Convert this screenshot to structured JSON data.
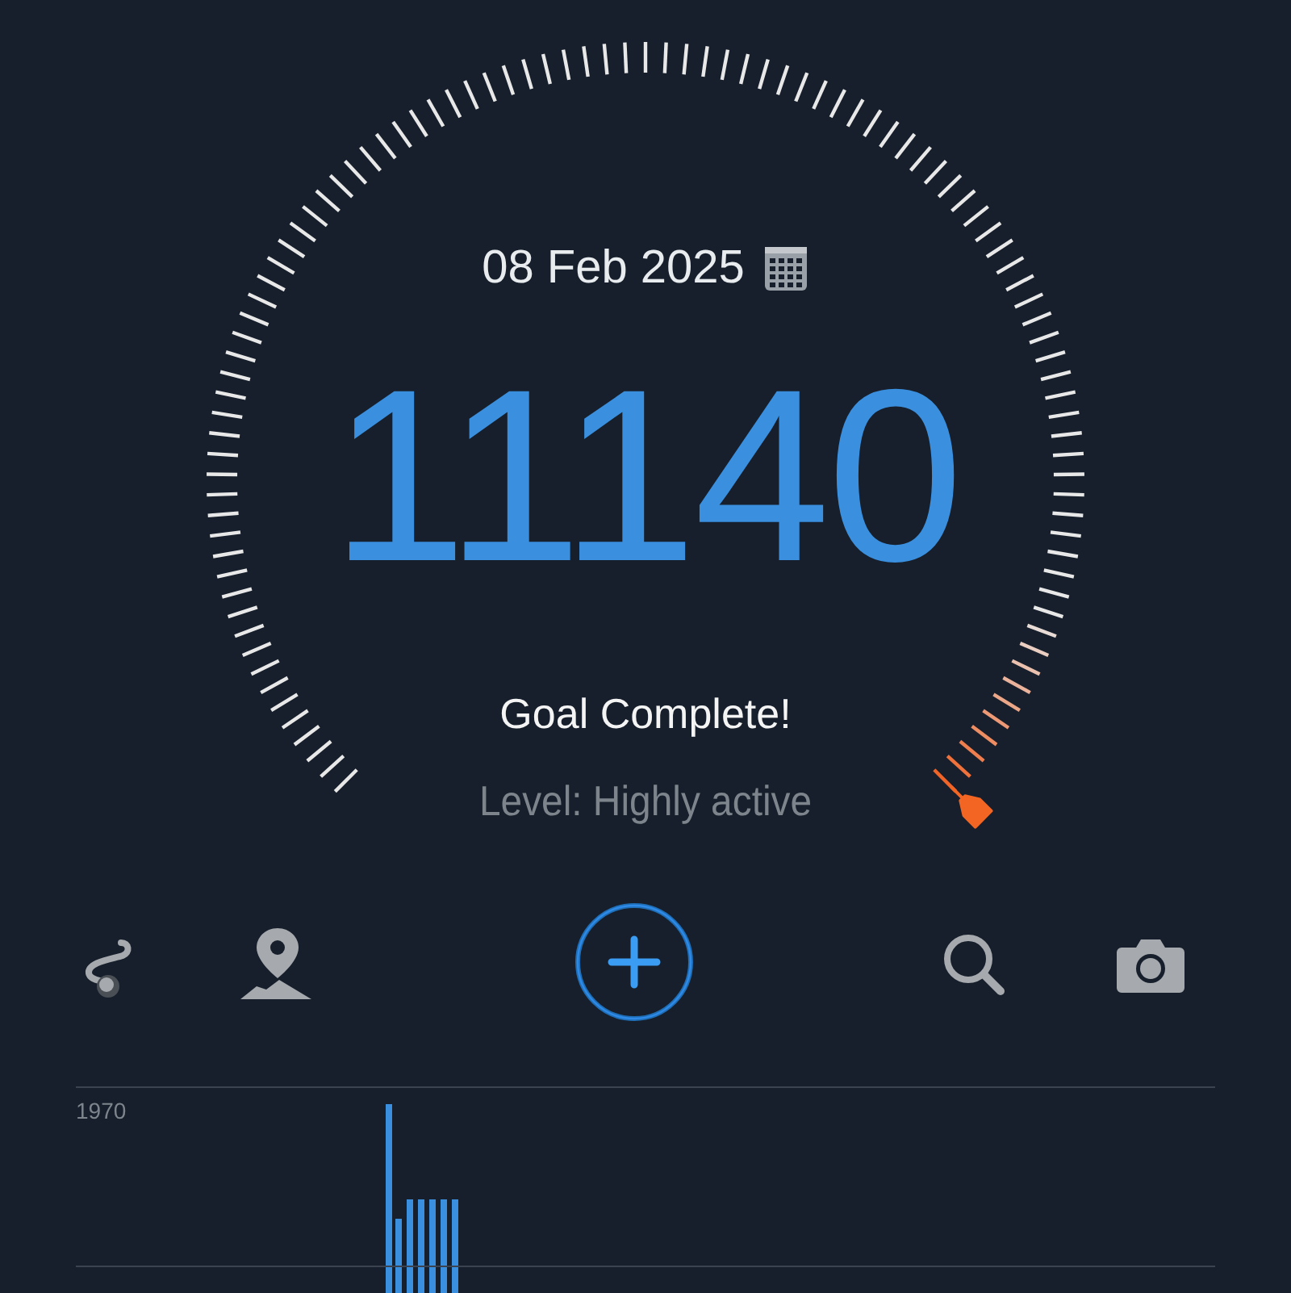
{
  "date": "08 Feb 2025",
  "steps": "11140",
  "status": "Goal Complete!",
  "activity_level": "Level: Highly active",
  "toolbar": [
    {
      "kind": "route"
    },
    {
      "kind": "map"
    },
    {
      "kind": "add"
    },
    {
      "kind": "search"
    },
    {
      "kind": "camera"
    }
  ],
  "chart": {
    "axis_label": "1970"
  }
}
